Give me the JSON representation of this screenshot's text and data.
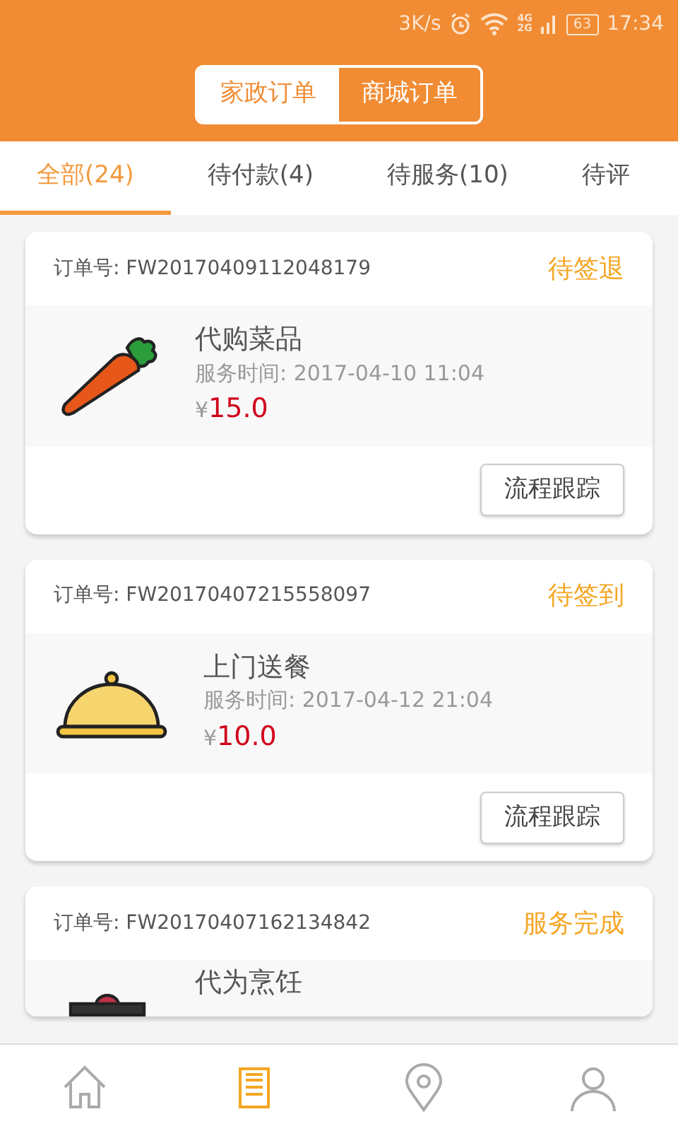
{
  "status_bar": {
    "speed": "3K/s",
    "network_labels": [
      "4G",
      "2G"
    ],
    "battery": "63",
    "time": "17:34"
  },
  "segments": [
    {
      "label": "家政订单",
      "selected": true
    },
    {
      "label": "商城订单",
      "selected": false
    }
  ],
  "tabs": [
    {
      "label": "全部(24)",
      "selected": true
    },
    {
      "label": "待付款(4)",
      "selected": false
    },
    {
      "label": "待服务(10)",
      "selected": false
    },
    {
      "label": "待评",
      "selected": false
    }
  ],
  "orders": [
    {
      "order_label": "订单号:",
      "order_no": "FW20170409112048179",
      "status": "待签退",
      "kind": "carrot",
      "title": "代购菜品",
      "time_label": "服务时间:",
      "time": "2017-04-10 11:04",
      "currency": "¥",
      "price": "15.0",
      "button": "流程跟踪"
    },
    {
      "order_label": "订单号:",
      "order_no": "FW20170407215558097",
      "status": "待签到",
      "kind": "cloche",
      "title": "上门送餐",
      "time_label": "服务时间:",
      "time": "2017-04-12 21:04",
      "currency": "¥",
      "price": "10.0",
      "button": "流程跟踪"
    },
    {
      "order_label": "订单号:",
      "order_no": "FW20170407162134842",
      "status": "服务完成",
      "kind": "pot",
      "title": "代为烹饪"
    }
  ],
  "bottom_nav": [
    {
      "kind": "home",
      "selected": false
    },
    {
      "kind": "orders",
      "selected": true
    },
    {
      "kind": "location",
      "selected": false
    },
    {
      "kind": "profile",
      "selected": false
    }
  ]
}
